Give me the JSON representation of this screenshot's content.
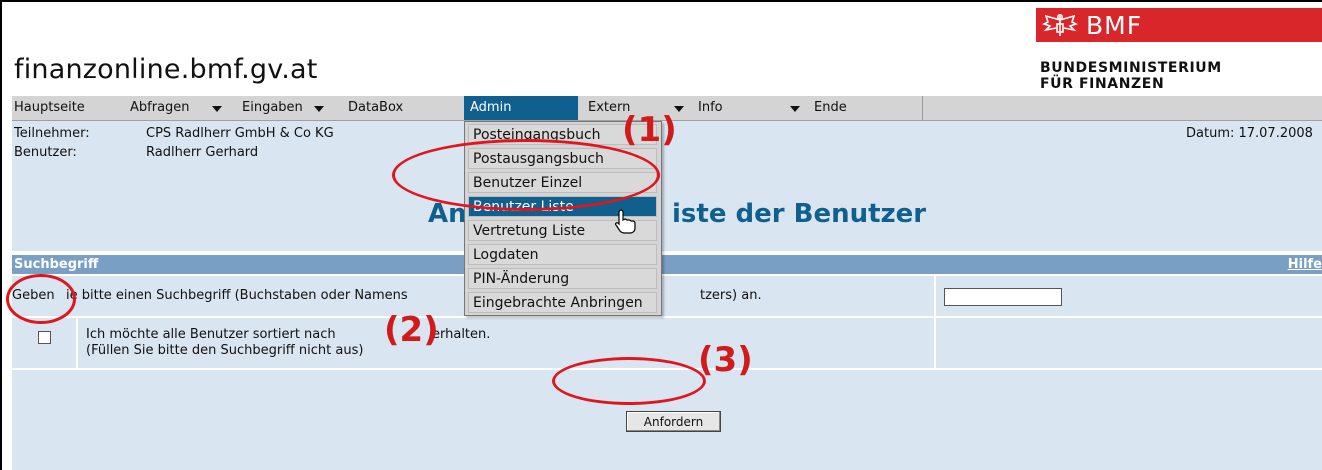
{
  "site": {
    "title": "finanzonline.bmf.gv.at"
  },
  "logo": {
    "abbr": "BMF",
    "line1": "BUNDESMINISTERIUM",
    "line2": "FÜR FINANZEN",
    "color": "#d9262b"
  },
  "menu": [
    {
      "label": "Hauptseite"
    },
    {
      "label": "Abfragen"
    },
    {
      "label": "Eingaben"
    },
    {
      "label": "DataBox"
    },
    {
      "label": "Admin"
    },
    {
      "label": "Extern"
    },
    {
      "label": "Info"
    },
    {
      "label": "Ende"
    }
  ],
  "info": {
    "participant_label": "Teilnehmer:",
    "participant_value": "CPS Radlherr GmbH & Co KG",
    "user_label": "Benutzer:",
    "user_value": "Radlherr Gerhard",
    "date": "Datum: 17.07.2008"
  },
  "page": {
    "heading_left": "An",
    "heading_right": "iste der Benutzer"
  },
  "search": {
    "section_label": "Suchbegriff",
    "help_label": "Hilfe",
    "prompt_a": "Geben ",
    "prompt_b": "ie bitte einen Suchbegriff (Buchstaben oder Namens",
    "prompt_c": "tzers) an.",
    "input_value": "",
    "checkbox_line1": "Ich möchte alle Benutzer sortiert nach ",
    "checkbox_line1b": "erhalten.",
    "checkbox_line2": "(Füllen Sie bitte den Suchbegriff nicht aus)",
    "submit_label": "Anfordern"
  },
  "admin_menu": [
    {
      "label": "Posteingangsbuch"
    },
    {
      "label": "Postausgangsbuch"
    },
    {
      "label": "Benutzer Einzel"
    },
    {
      "label": "Benutzer Liste"
    },
    {
      "label": "Vertretung Liste"
    },
    {
      "label": "Logdaten"
    },
    {
      "label": "PIN-Änderung"
    },
    {
      "label": "Eingebrachte Anbringen"
    }
  ],
  "annotations": {
    "a1": "(1)",
    "a2": "(2)",
    "a3": "(3)",
    "color": "#d11a1a"
  },
  "colors": {
    "accent": "#0f5f8f",
    "panel": "#d9e5f1",
    "section": "#7a9fc5",
    "menubar": "#d4d4d4"
  }
}
